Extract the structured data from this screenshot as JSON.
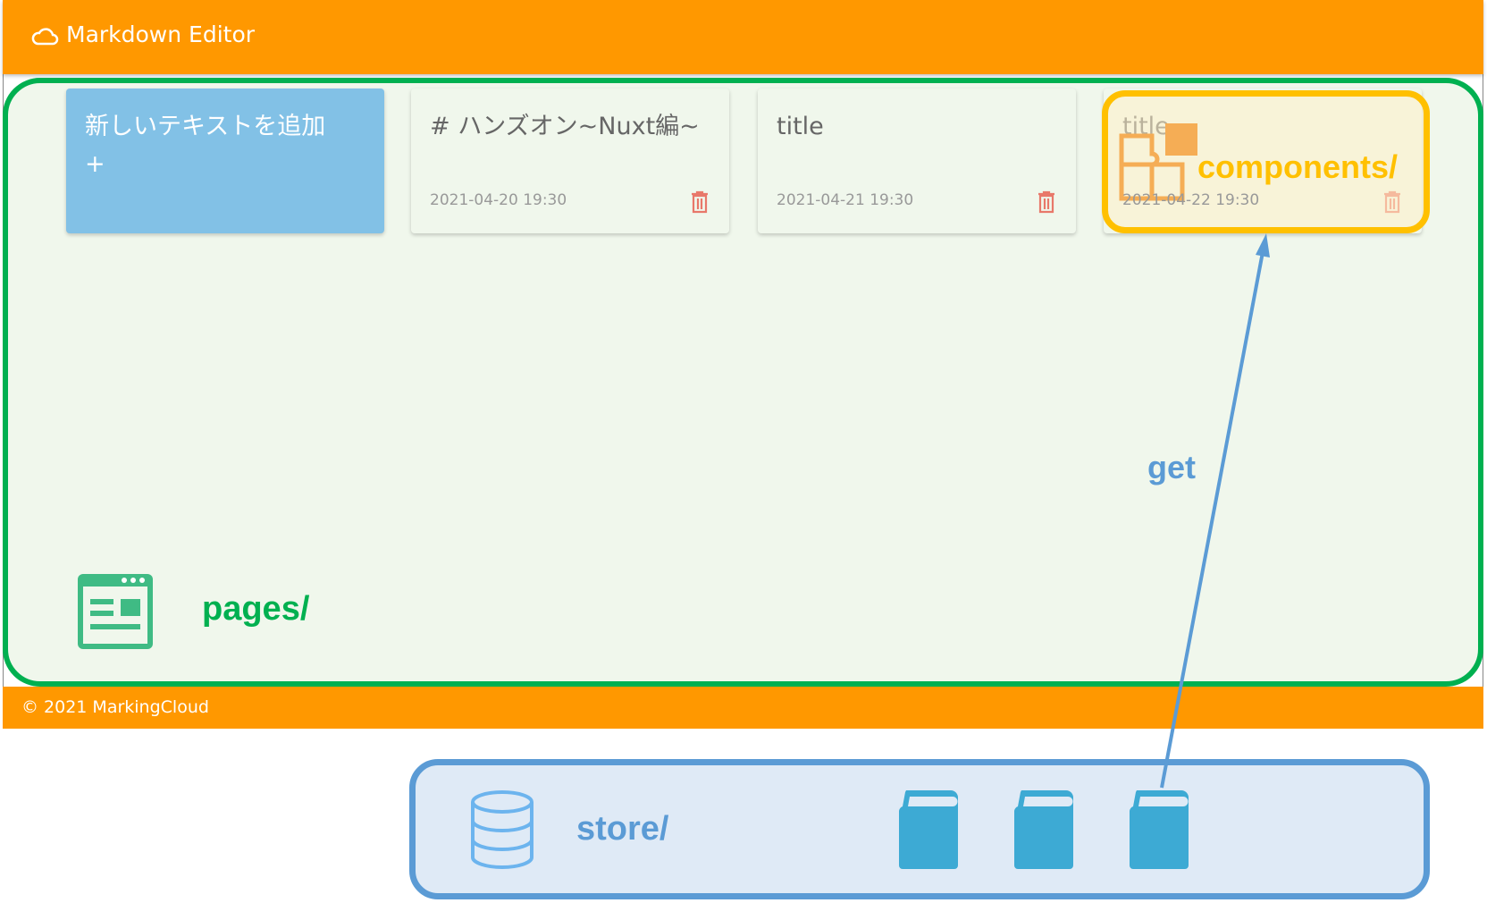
{
  "app": {
    "title": "Markdown Editor",
    "footer": "© 2021 MarkingCloud"
  },
  "cards": {
    "add_label": "新しいテキストを追加",
    "add_plus": "+",
    "items": [
      {
        "title": "# ハンズオン~Nuxt編~",
        "date": "2021-04-20 19:30"
      },
      {
        "title": "title",
        "date": "2021-04-21 19:30"
      },
      {
        "title": "title",
        "date": "2021-04-22 19:30"
      }
    ]
  },
  "diagram": {
    "pages_label": "pages/",
    "components_label": "components/",
    "store_label": "store/",
    "arrow_label": "get",
    "colors": {
      "pages": "#00b050",
      "components": "#ffc000",
      "store": "#5b9bd5",
      "header": "#ff9800"
    }
  }
}
